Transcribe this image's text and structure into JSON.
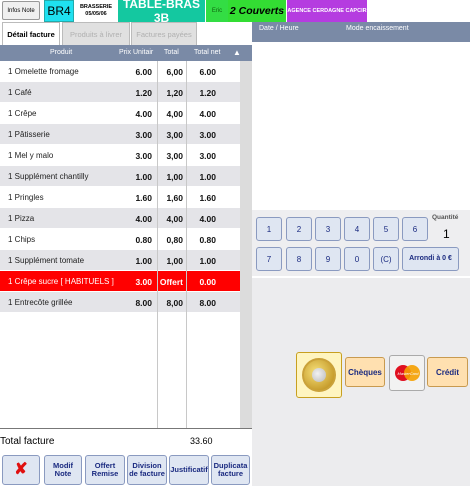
{
  "topbar": {
    "infos_note": "Infos Note",
    "table_code": "BR4",
    "brasserie_name": "BRASSERIE",
    "brasserie_date": "05/05/06",
    "table_name": "TABLE-BRAS 3B",
    "waiter": "Eric",
    "covers": "2 Couverts",
    "agency": "AGENCE CERDAGNE CAPCIR"
  },
  "tabs": [
    {
      "label": "Détail facture",
      "active": true
    },
    {
      "label": "Produits à livrer",
      "active": false
    },
    {
      "label": "Factures payées",
      "active": false
    }
  ],
  "table": {
    "headers": {
      "produit": "Produit",
      "prix": "Prix Unitair",
      "total": "Total",
      "net": "Total net"
    },
    "rows": [
      {
        "produit": "1 Omelette fromage",
        "prix": "6.00",
        "total": "6,00",
        "net": "6.00",
        "highlight": false
      },
      {
        "produit": "1 Café",
        "prix": "1.20",
        "total": "1,20",
        "net": "1.20",
        "highlight": false
      },
      {
        "produit": "1 Crêpe",
        "prix": "4.00",
        "total": "4,00",
        "net": "4.00",
        "highlight": false
      },
      {
        "produit": "1 Pâtisserie",
        "prix": "3.00",
        "total": "3,00",
        "net": "3.00",
        "highlight": false
      },
      {
        "produit": "1 Mel y malo",
        "prix": "3.00",
        "total": "3,00",
        "net": "3.00",
        "highlight": false
      },
      {
        "produit": "1 Supplément chantilly",
        "prix": "1.00",
        "total": "1,00",
        "net": "1.00",
        "highlight": false
      },
      {
        "produit": "1 Pringles",
        "prix": "1.60",
        "total": "1,60",
        "net": "1.60",
        "highlight": false
      },
      {
        "produit": "1 Pizza",
        "prix": "4.00",
        "total": "4,00",
        "net": "4.00",
        "highlight": false
      },
      {
        "produit": "1 Chips",
        "prix": "0.80",
        "total": "0,80",
        "net": "0.80",
        "highlight": false
      },
      {
        "produit": "1 Supplément tomate",
        "prix": "1.00",
        "total": "1,00",
        "net": "1.00",
        "highlight": false
      },
      {
        "produit": "1 Crêpe sucre [ HABITUELS ]",
        "prix": "3.00",
        "total": "Offert",
        "net": "0.00",
        "highlight": true
      },
      {
        "produit": "1 Entrecôte grillée",
        "prix": "8.00",
        "total": "8,00",
        "net": "8.00",
        "highlight": false
      }
    ]
  },
  "total": {
    "label": "Total facture",
    "value": "33.60"
  },
  "bottom_buttons": {
    "cancel": "✘",
    "modif_note": "Modif Note",
    "offert_remise": "Offert Remise",
    "division": "Division de facture",
    "justificatif": "Justificatif",
    "duplicata": "Duplicata facture"
  },
  "right_panel": {
    "header_date": "Date / Heure",
    "header_mode": "Mode encaissement"
  },
  "keypad": {
    "row1": [
      "1",
      "2",
      "3",
      "4",
      "5",
      "6"
    ],
    "row2": [
      "7",
      "8",
      "9",
      "0"
    ],
    "clear": "(C)",
    "arrondi": "Arrondi à 0 €",
    "quantite_label": "Quantité",
    "quantite_value": "1"
  },
  "payment": {
    "cheques": "Chèques",
    "mastercard": "MasterCard",
    "credit": "Crédit"
  },
  "icons": {
    "cancel": "cross-icon",
    "coin": "euro-coin-icon",
    "card": "mastercard-icon",
    "scroll": "scroll-up-icon"
  },
  "colors": {
    "table_code_bg": "#1fe0f0",
    "table_name_bg": "#14c8a0",
    "covers_bg": "#33dd33",
    "agency_bg": "#b53ce0",
    "header_bg": "#7a8aa6",
    "highlight_row": "#ff0000",
    "cancel_red": "#e01010"
  }
}
